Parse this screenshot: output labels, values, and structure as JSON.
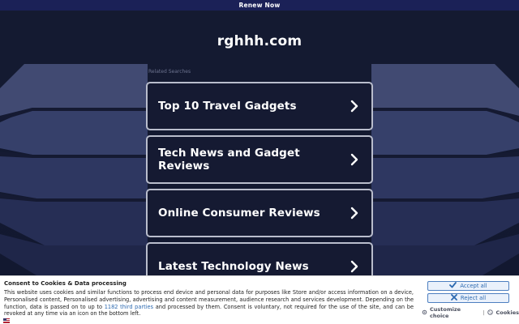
{
  "topbar": {
    "label": "Renew Now"
  },
  "site": {
    "domain": "rghhh.com",
    "related_label": "Related Searches"
  },
  "links": [
    {
      "label": "Top 10 Travel Gadgets"
    },
    {
      "label": "Tech News and Gadget Reviews"
    },
    {
      "label": "Online Consumer Reviews"
    },
    {
      "label": "Latest Technology News"
    }
  ],
  "consent": {
    "title": "Consent to Cookies & Data processing",
    "text_before": "This website uses cookies and similar functions to process end device and personal data for purposes like Store and/or access information on a device, Personalised content, Personalised advertising, advertising and content measurement, audience research and services development. Depending on the function, data is passed on to up to ",
    "third_parties_link": "1182 third parties",
    "text_after": " and processed by them. Consent is voluntary, not required for the use of the site, and can be revoked at any time via an icon on the bottom left.",
    "accept_label": "Accept all",
    "reject_label": "Reject all",
    "customize_label": "Customize choice",
    "separator": "|",
    "cookies_label": "Cookies"
  },
  "colors": {
    "topbar_bg": "#1b2157",
    "page_bg": "#141a31",
    "card_border": "#b9bdcc",
    "accent_blue": "#2d6ab0"
  },
  "icons": {
    "card_arrow": "chevron-right-icon",
    "accept": "check-icon",
    "reject": "close-icon",
    "customize": "gear-icon",
    "cookies": "cookie-icon",
    "flag": "flag-icon"
  }
}
